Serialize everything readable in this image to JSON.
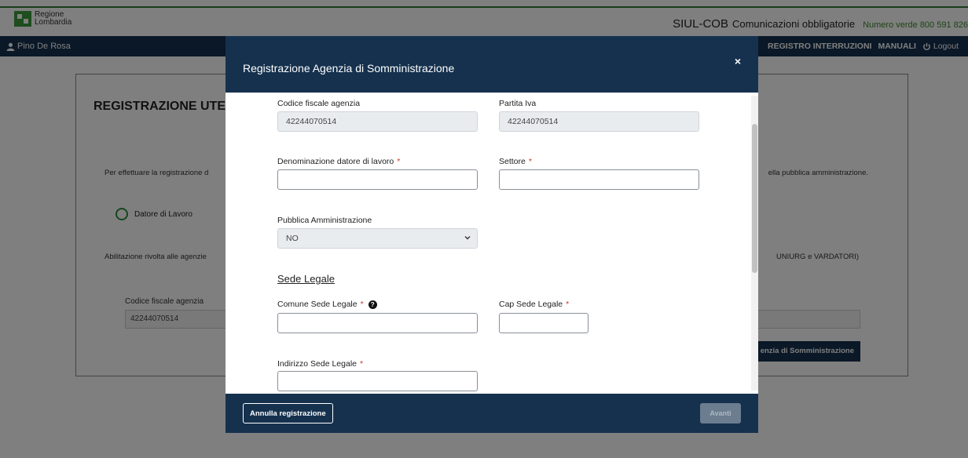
{
  "header": {
    "logo_text": "Regione Lombardia",
    "app_title": "SIUL-COB",
    "app_subtitle": "Comunicazioni obbligatorie",
    "phone": "Numero verde 800 591 826"
  },
  "navbar": {
    "user": "Pino De Rosa",
    "links": [
      "REGISTRO INTERRUZIONI",
      "MANUALI"
    ],
    "logout": "Logout"
  },
  "page": {
    "title": "REGISTRAZIONE UTENT",
    "intro_left": "Per effettuare la registrazione d",
    "intro_right": "ella pubblica amministrazione.",
    "radio_label": "Datore di Lavoro",
    "abil_left": "Abilitazione rivolta alle agenzie",
    "abil_right": "UNIURG e VARDATORI)",
    "cf_label": "Codice fiscale agenzia",
    "cf_value": "42244070514",
    "button_partial": "enzia di Somministrazione"
  },
  "modal": {
    "title": "Registrazione Agenzia di Somministrazione",
    "close": "×",
    "fields": {
      "codice_fiscale_label": "Codice fiscale agenzia",
      "codice_fiscale_value": "42244070514",
      "partita_iva_label": "Partita Iva",
      "partita_iva_value": "42244070514",
      "denominazione_label": "Denominazione datore di lavoro",
      "denominazione_value": "",
      "settore_label": "Settore",
      "settore_value": "",
      "pa_label": "Pubblica Amministrazione",
      "pa_value": "NO",
      "sede_legale_title": "Sede Legale",
      "comune_label": "Comune Sede Legale",
      "comune_value": "",
      "cap_label": "Cap Sede Legale",
      "cap_value": "",
      "indirizzo_label": "Indirizzo Sede Legale",
      "indirizzo_value": ""
    },
    "required_mark": "*",
    "help_glyph": "?",
    "footer": {
      "cancel": "Annulla registrazione",
      "next": "Avanti"
    }
  },
  "colors": {
    "navy": "#15314e",
    "brand_green": "#3c9a3c",
    "required_red": "#d0342c"
  }
}
